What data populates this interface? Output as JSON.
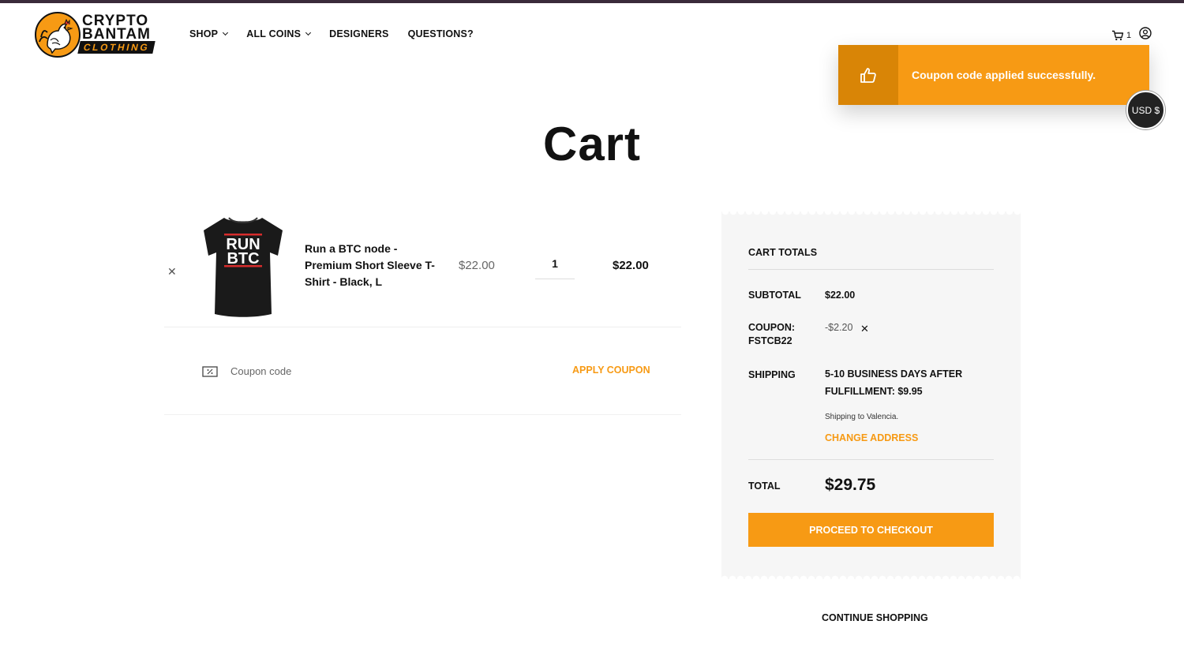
{
  "logo": {
    "line1": "CRYPTO",
    "line2": "BANTAM",
    "line3": "CLOTHING"
  },
  "nav": {
    "items": [
      {
        "label": "SHOP",
        "dropdown": true
      },
      {
        "label": "ALL COINS",
        "dropdown": true
      },
      {
        "label": "DESIGNERS",
        "dropdown": false
      },
      {
        "label": "QUESTIONS?",
        "dropdown": false
      }
    ]
  },
  "header": {
    "cart_count": "1",
    "cart_icon": "cart-icon",
    "account_icon": "user-icon"
  },
  "toast": {
    "message": "Coupon code applied successfully.",
    "icon": "thumbs-up-icon"
  },
  "currency": {
    "label": "USD $"
  },
  "page": {
    "title": "Cart"
  },
  "cart": {
    "items": [
      {
        "image_text_1": "RUN",
        "image_text_2": "BTC",
        "name": "Run a BTC node - Premium Short Sleeve T-Shirt - Black, L",
        "price": "$22.00",
        "quantity": "1",
        "subtotal": "$22.00"
      }
    ],
    "coupon": {
      "placeholder": "Coupon code",
      "apply_label": "APPLY COUPON"
    }
  },
  "totals": {
    "heading": "CART TOTALS",
    "subtotal_label": "SUBTOTAL",
    "subtotal_value": "$22.00",
    "coupon_label_1": "COUPON:",
    "coupon_label_2": "FSTCB22",
    "coupon_value": "-$2.20",
    "shipping_label": "SHIPPING",
    "shipping_line_1": "5-10 BUSINESS DAYS AFTER",
    "shipping_line_2": "FULFILLMENT: $9.95",
    "shipping_dest": "Shipping to Valencia.",
    "change_address": "CHANGE ADDRESS",
    "total_label": "TOTAL",
    "total_value": "$29.75",
    "checkout_label": "PROCEED TO CHECKOUT",
    "continue_label": "CONTINUE SHOPPING"
  },
  "colors": {
    "accent": "#f79a14",
    "accent_dark": "#d98506",
    "text": "#111111"
  }
}
